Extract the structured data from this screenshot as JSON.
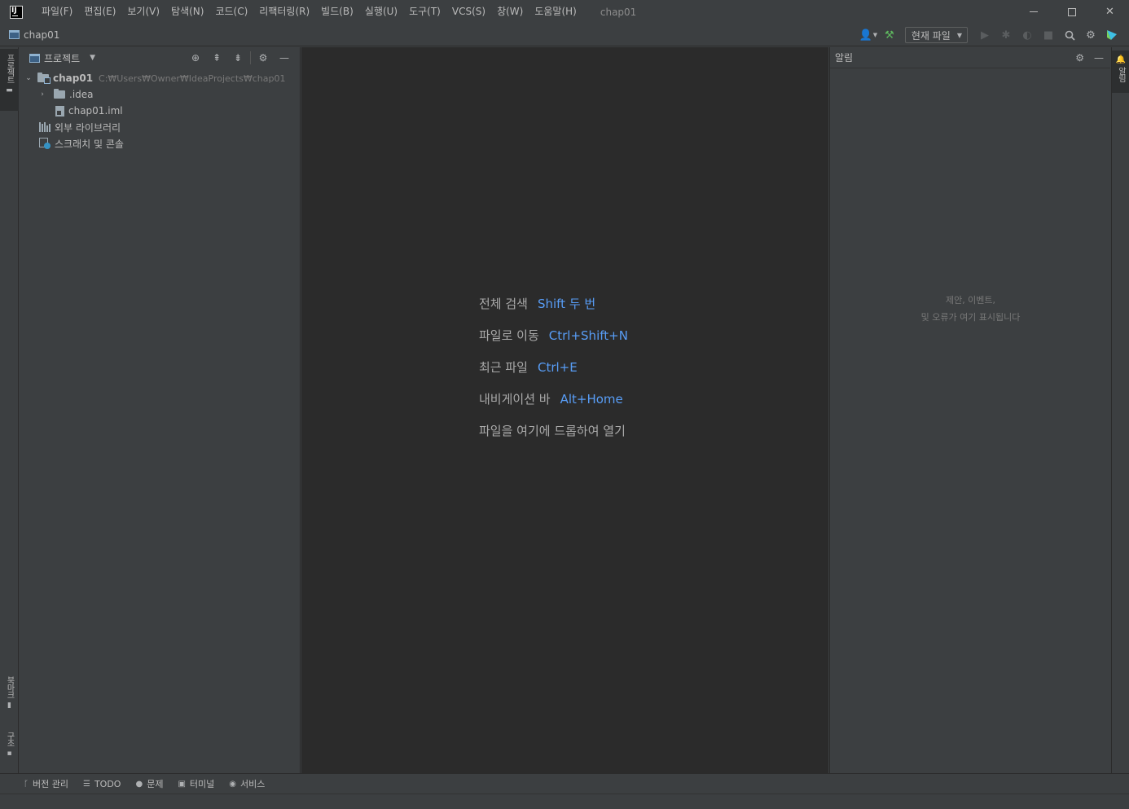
{
  "titlebar": {
    "menu": [
      "파일(F)",
      "편집(E)",
      "보기(V)",
      "탐색(N)",
      "코드(C)",
      "리팩터링(R)",
      "빌드(B)",
      "실행(U)",
      "도구(T)",
      "VCS(S)",
      "창(W)",
      "도움말(H)"
    ],
    "project_title": "chap01"
  },
  "navbar": {
    "breadcrumb": "chap01",
    "run_config": "현재 파일"
  },
  "left_strip": {
    "project_tab": "프로젝트",
    "bookmarks_tab": "북마크",
    "structure_tab": "구조"
  },
  "project_panel": {
    "title": "프로젝트",
    "tree": {
      "root_name": "chap01",
      "root_path": "C:₩Users₩Owner₩IdeaProjects₩chap01",
      "idea_folder": ".idea",
      "iml_file": "chap01.iml",
      "external_libraries": "외부 라이브러리",
      "scratches": "스크래치 및 콘솔"
    }
  },
  "editor": {
    "hints": [
      {
        "label": "전체 검색",
        "key": "Shift 두 번"
      },
      {
        "label": "파일로 이동",
        "key": "Ctrl+Shift+N"
      },
      {
        "label": "최근 파일",
        "key": "Ctrl+E"
      },
      {
        "label": "내비게이션 바",
        "key": "Alt+Home"
      },
      {
        "label": "파일을 여기에 드롭하여 열기",
        "key": ""
      }
    ]
  },
  "notifications": {
    "title": "알림",
    "empty_line1": "제안, 이벤트,",
    "empty_line2": "및 오류가 여기 표시됩니다"
  },
  "right_strip": {
    "notifications_tab": "알림"
  },
  "bottom_bar": {
    "tabs": [
      "버전 관리",
      "TODO",
      "문제",
      "터미널",
      "서비스"
    ]
  },
  "colors": {
    "panel_bg": "#3c3f41",
    "editor_bg": "#2b2b2b",
    "shortcut_blue": "#589df6",
    "hint_gray": "#a9a9a9"
  }
}
